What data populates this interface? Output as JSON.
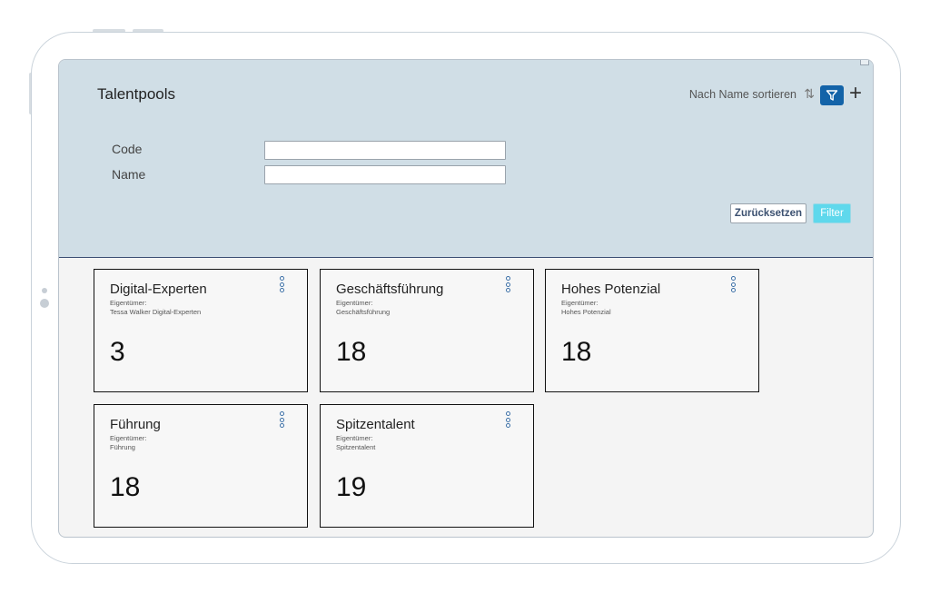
{
  "header": {
    "title": "Talentpools",
    "sort_label": "Nach Name sortieren",
    "sort_icon": "sort-arrows-icon",
    "filter_icon": "funnel-icon",
    "add_icon": "plus-icon",
    "accent_color": "#1363a8"
  },
  "filter_form": {
    "code_label": "Code",
    "code_value": "",
    "name_label": "Name",
    "name_value": "",
    "reset_label": "Zurücksetzen",
    "apply_label": "Filter"
  },
  "cards": [
    {
      "title": "Digital-Experten",
      "owner_label": "Eigentümer:",
      "owner": "Tessa Walker Digital-Experten",
      "count": "3"
    },
    {
      "title": "Geschäftsführung",
      "owner_label": "Eigentümer:",
      "owner": "Geschäftsführung",
      "count": "18"
    },
    {
      "title": "Hohes Potenzial",
      "owner_label": "Eigentümer:",
      "owner": "Hohes Potenzial",
      "count": "18"
    },
    {
      "title": "Führung",
      "owner_label": "Eigentümer:",
      "owner": "Führung",
      "count": "18"
    },
    {
      "title": "Spitzentalent",
      "owner_label": "Eigentümer:",
      "owner": "Spitzentalent",
      "count": "19"
    }
  ]
}
